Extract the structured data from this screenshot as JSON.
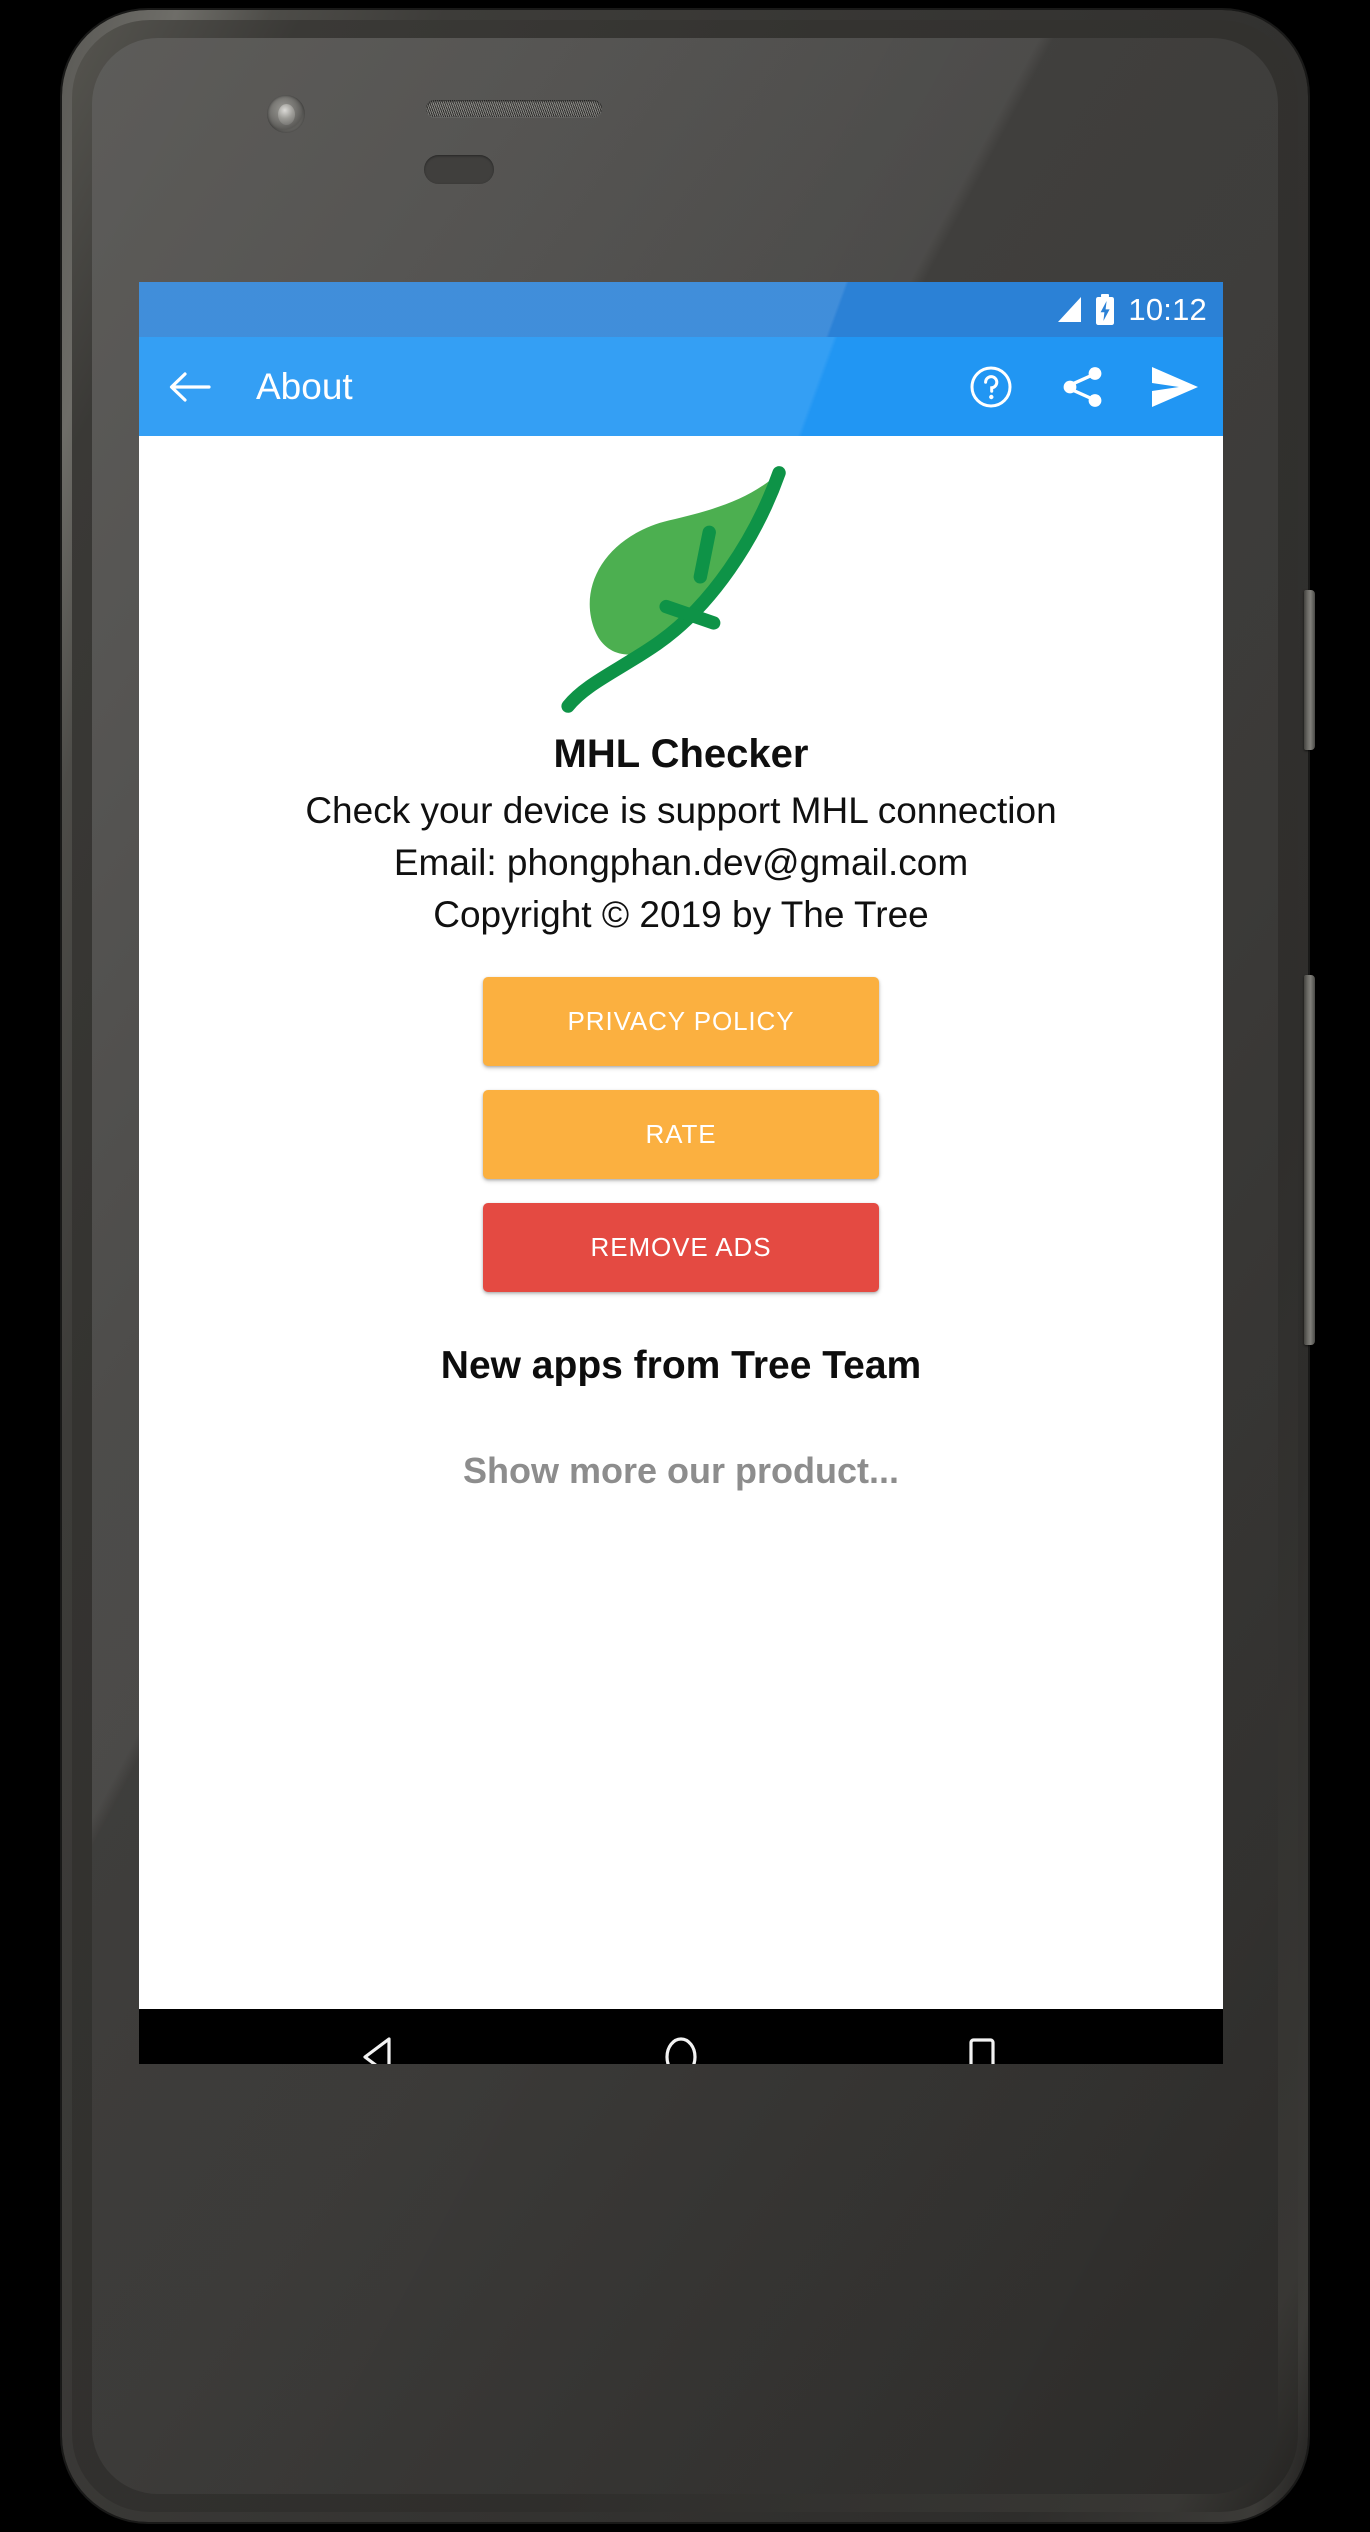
{
  "device": {
    "hardware": {
      "front_camera": "front-camera",
      "earpiece": "earpiece-speaker",
      "proximity_sensor": "proximity-sensor",
      "power_button": "power-button",
      "volume_button": "volume-rocker"
    }
  },
  "status_bar": {
    "time": "10:12",
    "signal_icon": "signal-bars-icon",
    "battery_icon": "battery-charging-icon",
    "background_color": "#2b81d6"
  },
  "app_bar": {
    "title": "About",
    "background_color": "#2196f3",
    "back_icon": "arrow-left-icon",
    "actions": [
      {
        "name": "help-icon",
        "label": "Help"
      },
      {
        "name": "share-icon",
        "label": "Share"
      },
      {
        "name": "send-icon",
        "label": "Send"
      }
    ]
  },
  "content": {
    "logo": {
      "name": "leaf-logo",
      "leaf_fill": "#4caf50",
      "stem_color": "#0e9347"
    },
    "app_name": "MHL Checker",
    "description": "Check your device is support MHL connection",
    "email": "Email: phongphan.dev@gmail.com",
    "copyright": "Copyright © 2019 by The Tree",
    "buttons": [
      {
        "label": "PRIVACY POLICY",
        "color": "#fbb040",
        "name": "privacy-policy-button"
      },
      {
        "label": "RATE",
        "color": "#fbb040",
        "name": "rate-button"
      },
      {
        "label": "REMOVE ADS",
        "color": "#e44a42",
        "name": "remove-ads-button"
      }
    ],
    "section_heading": "New apps from Tree Team",
    "show_more": "Show more our product..."
  },
  "nav_bar": {
    "background_color": "#000000",
    "buttons": [
      {
        "name": "nav-back-button",
        "icon": "triangle-left-icon"
      },
      {
        "name": "nav-home-button",
        "icon": "circle-icon"
      },
      {
        "name": "nav-recents-button",
        "icon": "square-icon"
      }
    ]
  }
}
